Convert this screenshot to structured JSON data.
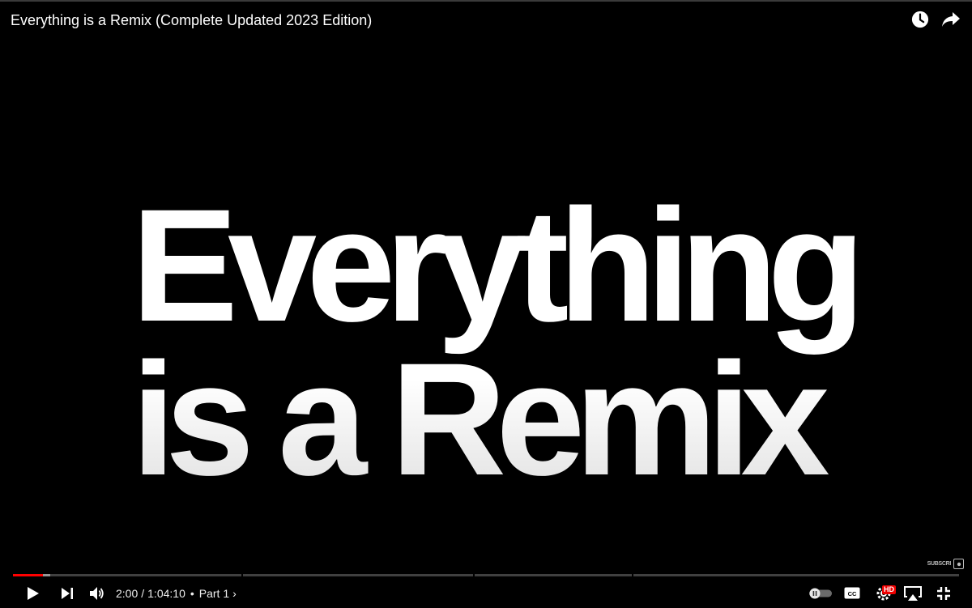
{
  "window": {
    "title": "Everything is a Remix (Complete Updated 2023 Edition)"
  },
  "top_actions": {
    "watch_later_icon": "clock-icon",
    "share_icon": "share-arrow-icon"
  },
  "video": {
    "frame_text_line1": "Everything",
    "frame_text_line2": "is a Remix",
    "watermark_text": "SUBSCRI"
  },
  "progress": {
    "played_fraction": 0.032,
    "buffered_fraction": 0.039,
    "chapter_markers": [
      0.2413,
      0.4866,
      0.6538
    ]
  },
  "controls": {
    "current_time": "2:00",
    "time_separator": "/",
    "duration": "1:04:10",
    "chapter_dot": "•",
    "chapter_label": "Part 1",
    "chapter_chevron": "›",
    "hd_badge": "HD"
  },
  "colors": {
    "accent": "#ff0000",
    "background": "#000000",
    "text": "#ffffff"
  }
}
